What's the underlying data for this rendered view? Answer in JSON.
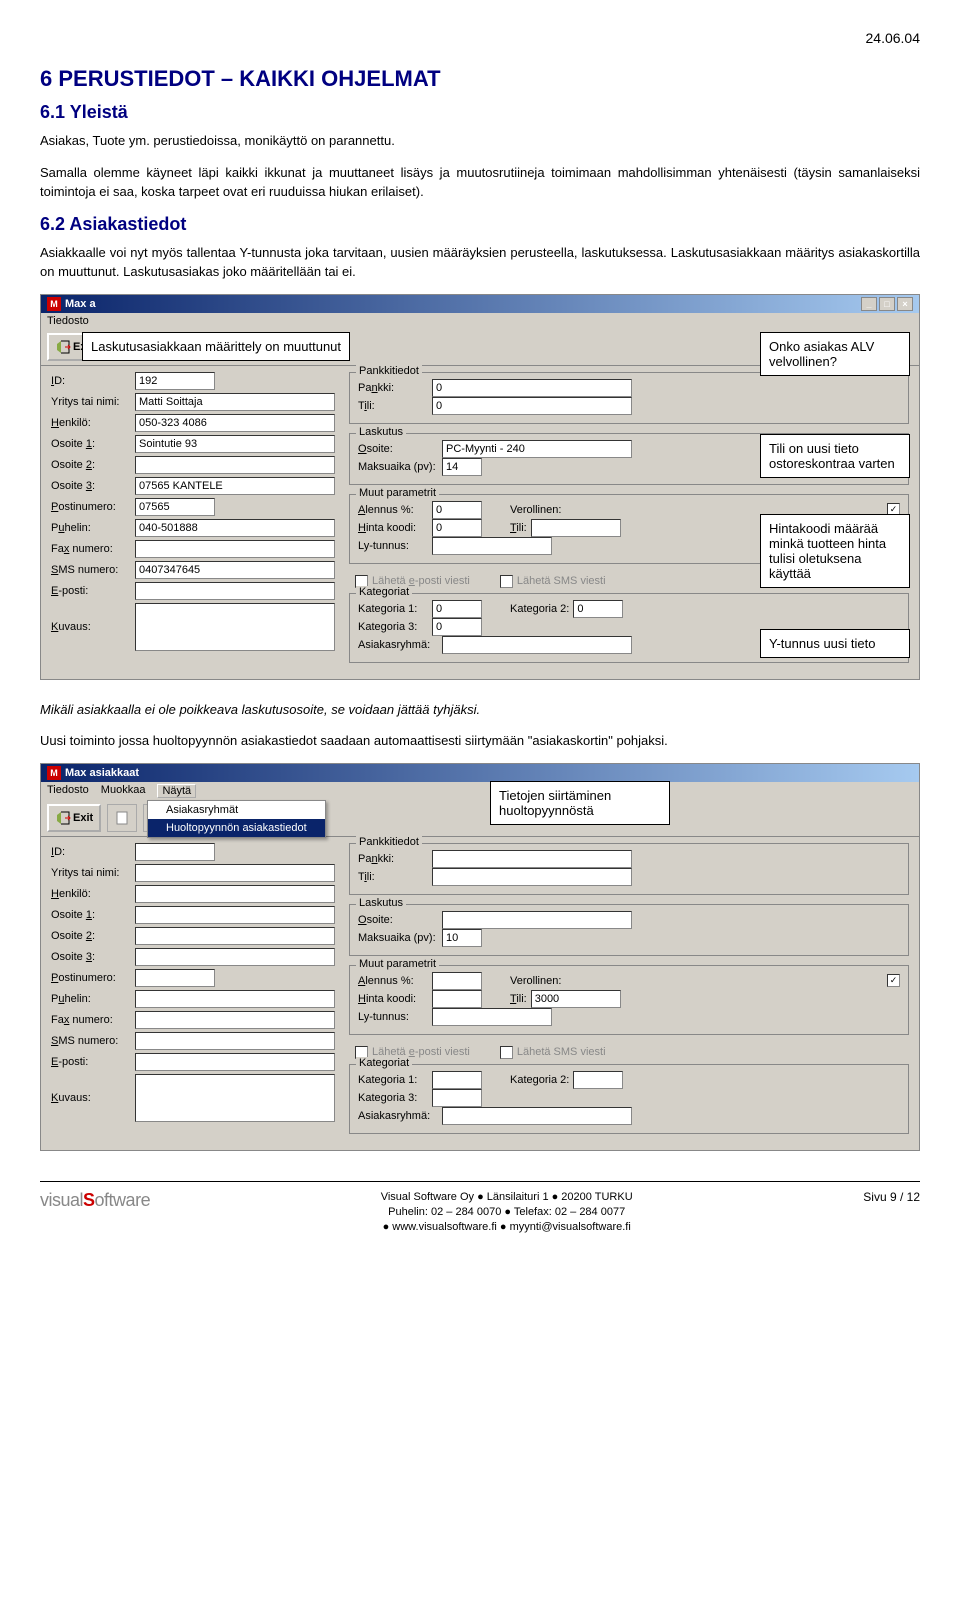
{
  "page": {
    "date": "24.06.04",
    "pagenum": "Sivu 9 / 12"
  },
  "headings": {
    "h1": "6  PERUSTIEDOT – KAIKKI OHJELMAT",
    "h2a": "6.1 Yleistä",
    "h2b": "6.2 Asiakastiedot"
  },
  "paras": {
    "p1": "Asiakas, Tuote ym. perustiedoissa, monikäyttö on parannettu.",
    "p2": "Samalla olemme käyneet läpi kaikki ikkunat ja muuttaneet lisäys ja muutosrutiineja toimimaan mahdollisimman yhtenäisesti (täysin samanlaiseksi toimintoja ei saa, koska tarpeet ovat eri ruuduissa hiukan erilaiset).",
    "p3": "Asiakkaalle voi nyt myös tallentaa Y-tunnusta joka tarvitaan, uusien määräyksien perusteella, laskutuksessa. Laskutusasiakkaan määritys asiakaskortilla on muuttunut. Laskutusasiakas joko määritellään tai ei.",
    "p4": "Mikäli asiakkaalla ei ole poikkeava laskutusosoite, se voidaan jättää tyhjäksi.",
    "p5": "Uusi toiminto jossa huoltopyynnön asiakastiedot saadaan automaattisesti siirtymään \"asiakaskortin\" pohjaksi."
  },
  "callouts": {
    "c1": "Laskutusasiakkaan määrittely on muuttunut",
    "c2": "Onko asiakas ALV velvollinen?",
    "c3": "Tili on uusi tieto ostoreskontraa varten",
    "c4": "Hintakoodi määrää minkä tuotteen hinta tulisi oletuksena käyttää",
    "c5": "Y-tunnus uusi tieto",
    "c6": "Tietojen siirtäminen huoltopyynnöstä"
  },
  "win1": {
    "title": "Max a",
    "menu": {
      "tiedosto": "Tiedosto"
    },
    "exit": "Exit",
    "labels": {
      "id": "ID:",
      "yritys": "Yritys tai nimi:",
      "henkilo": "Henkilö:",
      "osoite1": "Osoite 1:",
      "osoite2": "Osoite 2:",
      "osoite3": "Osoite 3:",
      "postinumero": "Postinumero:",
      "puhelin": "Puhelin:",
      "fax": "Fax numero:",
      "sms": "SMS numero:",
      "eposti": "E-posti:",
      "kuvaus": "Kuvaus:",
      "pankkitiedot": "Pankkitiedot",
      "pankki": "Pankki:",
      "tili_p": "Tili:",
      "laskutus": "Laskutus",
      "osoite": "Osoite:",
      "maksuaika": "Maksuaika (pv):",
      "muut": "Muut parametrit",
      "alennus": "Alennus %:",
      "hintakoodi": "Hinta koodi:",
      "lytunnus": "Ly-tunnus:",
      "verollinen": "Verollinen:",
      "tili": "Tili:",
      "laheta_email": "Lähetä e-posti viesti",
      "laheta_sms": "Lähetä SMS viesti",
      "kategoriat": "Kategoriat",
      "kat1": "Kategoria 1:",
      "kat2": "Kategoria 2:",
      "kat3": "Kategoria 3:",
      "asiakasryhma": "Asiakasryhmä:"
    },
    "vals": {
      "id": "192",
      "yritys": "Matti Soittaja",
      "henkilo": "050-323 4086",
      "osoite1": "Sointutie 93",
      "osoite3": "07565 KANTELE",
      "postinumero": "07565",
      "puhelin": "040-501888",
      "sms": "0407347645",
      "pankki": "0",
      "tili_p": "0",
      "osoite": "PC-Myynti - 240",
      "maksuaika": "14",
      "alennus": "0",
      "hintakoodi": "0",
      "kat1": "0",
      "kat2": "0",
      "kat3": "0"
    }
  },
  "win2": {
    "title": "Max asiakkaat",
    "menu": {
      "tiedosto": "Tiedosto",
      "muokkaa": "Muokkaa",
      "nayta": "Näytä"
    },
    "exit": "Exit",
    "dropdown": {
      "item1": "Asiakasryhmät",
      "item2": "Huoltopyynnön asiakastiedot"
    },
    "labels": {
      "id": "ID:",
      "yritys": "Yritys tai nimi:",
      "henkilo": "Henkilö:",
      "osoite1": "Osoite 1:",
      "osoite2": "Osoite 2:",
      "osoite3": "Osoite 3:",
      "postinumero": "Postinumero:",
      "puhelin": "Puhelin:",
      "fax": "Fax numero:",
      "sms": "SMS numero:",
      "eposti": "E-posti:",
      "kuvaus": "Kuvaus:",
      "pankkitiedot": "Pankkitiedot",
      "pankki": "Pankki:",
      "tili_p": "Tili:",
      "laskutus": "Laskutus",
      "osoite": "Osoite:",
      "maksuaika": "Maksuaika (pv):",
      "muut": "Muut parametrit",
      "alennus": "Alennus %:",
      "hintakoodi": "Hinta koodi:",
      "lytunnus": "Ly-tunnus:",
      "verollinen": "Verollinen:",
      "tili": "Tili:",
      "laheta_email": "Lähetä e-posti viesti",
      "laheta_sms": "Lähetä SMS viesti",
      "kategoriat": "Kategoriat",
      "kat1": "Kategoria 1:",
      "kat2": "Kategoria 2:",
      "kat3": "Kategoria 3:",
      "asiakasryhma": "Asiakasryhmä:"
    },
    "vals": {
      "maksuaika": "10",
      "tili": "3000"
    }
  },
  "footer": {
    "line1": "Visual Software Oy ● Länsilaituri 1 ● 20200 TURKU",
    "line2": "Puhelin: 02 – 284 0070 ● Telefax: 02 – 284 0077",
    "line3": "● www.visualsoftware.fi ● myynti@visualsoftware.fi"
  }
}
